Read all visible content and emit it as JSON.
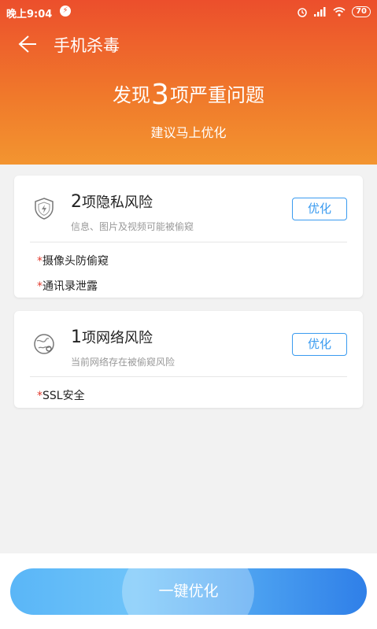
{
  "status_bar": {
    "time": "晚上9:04",
    "battery": "70"
  },
  "titlebar": {
    "title": "手机杀毒"
  },
  "summary": {
    "prefix": "发现",
    "count": "3",
    "suffix": "项严重问题",
    "subtitle": "建议马上优化"
  },
  "cards": [
    {
      "count": "2",
      "title": "项隐私风险",
      "desc": "信息、图片及视频可能被偷窥",
      "button": "优化",
      "items": [
        {
          "mark": "*",
          "text": "摄像头防偷窥"
        },
        {
          "mark": "*",
          "text": "通讯录泄露"
        }
      ]
    },
    {
      "count": "1",
      "title": "项网络风险",
      "desc": "当前网络存在被偷窥风险",
      "button": "优化",
      "items": [
        {
          "mark": "*",
          "text": "SSL安全"
        }
      ]
    }
  ],
  "action": {
    "label": "一键优化"
  },
  "colors": {
    "header_top": "#ec4f2c",
    "header_bottom": "#f39530",
    "accent_blue": "#3a9bf0",
    "alert_red": "#e23b2e"
  },
  "icons": [
    "back-arrow-icon",
    "shield-icon",
    "globe-icon",
    "alarm-icon",
    "signal-icon",
    "wifi-icon",
    "battery-icon"
  ]
}
